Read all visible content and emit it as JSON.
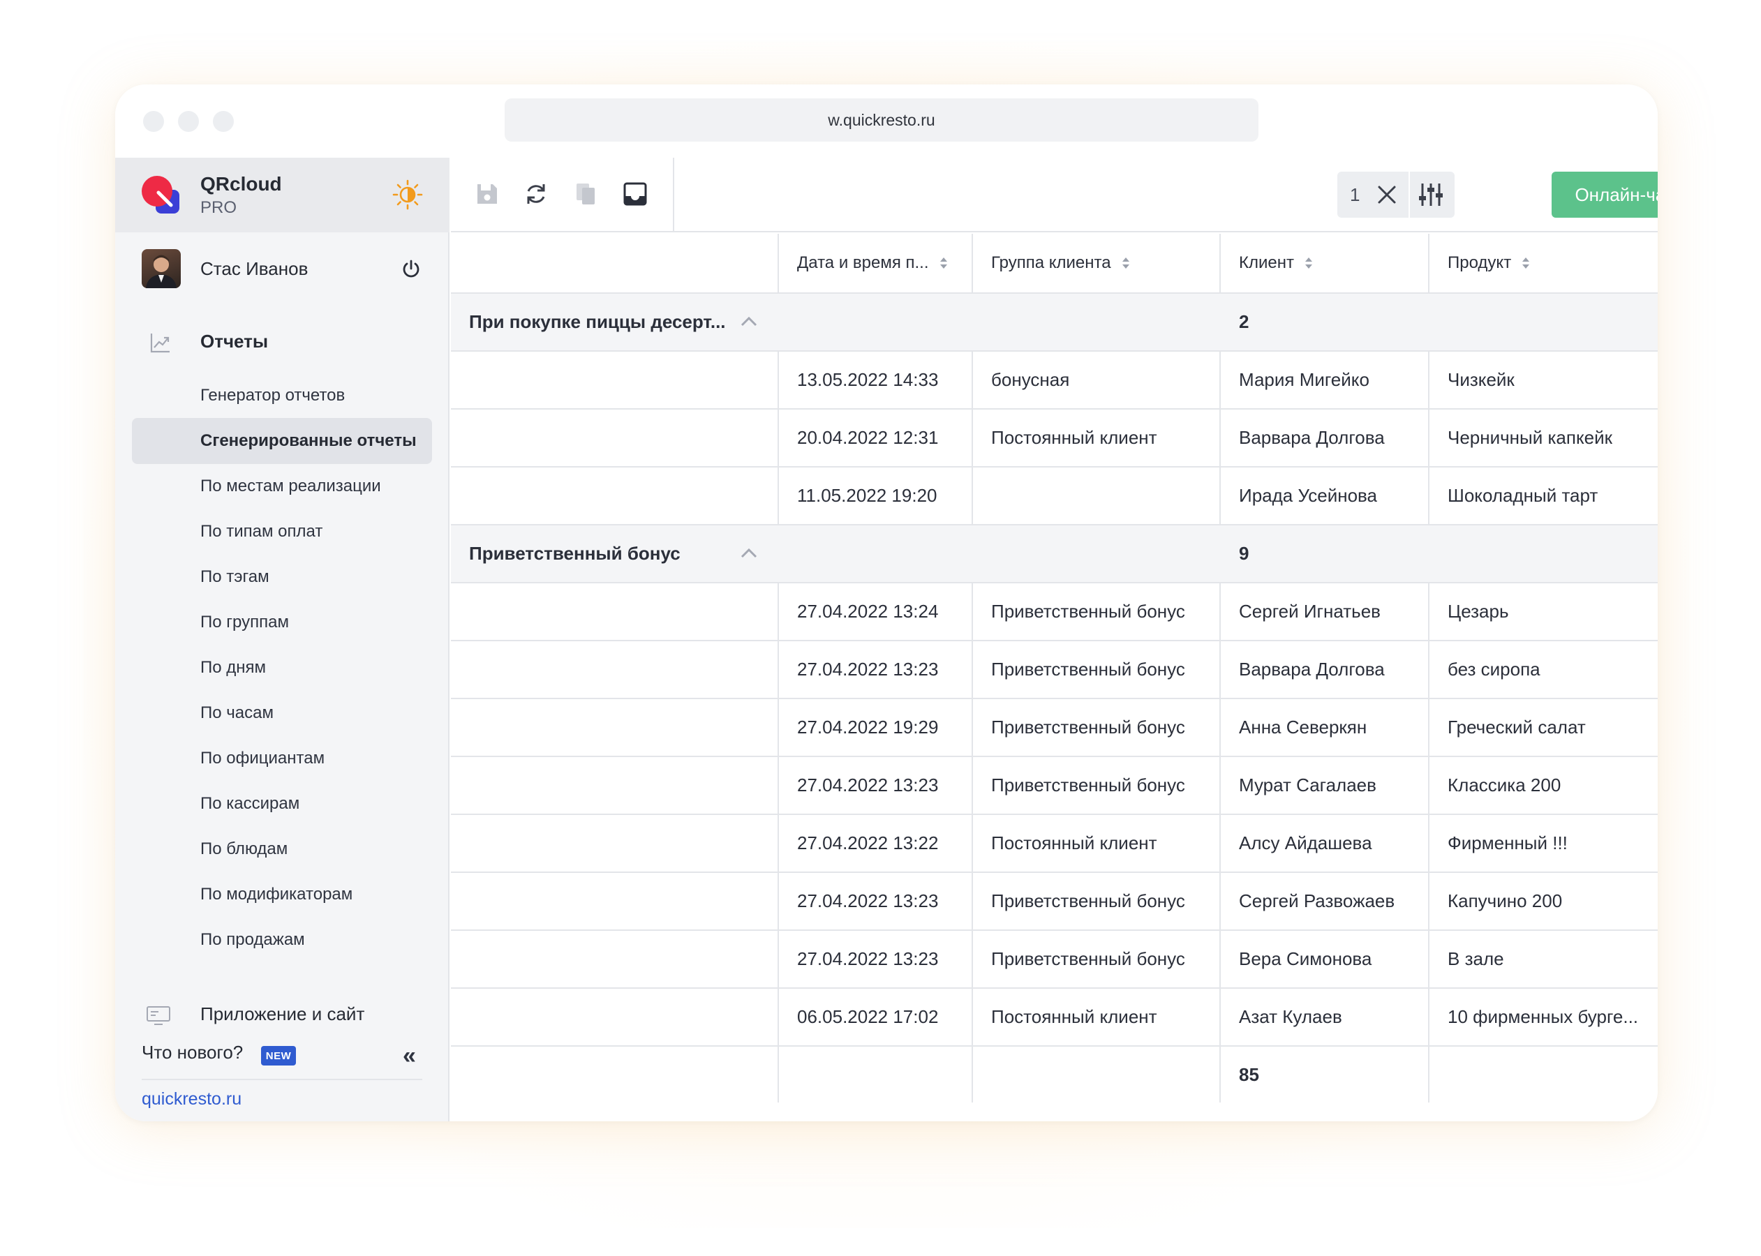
{
  "browser": {
    "url": "w.quickresto.ru"
  },
  "brand": {
    "name": "QRcloud",
    "tier": "PRO"
  },
  "user": {
    "name": "Стас Иванов"
  },
  "sidebar": {
    "section_title": "Отчеты",
    "items": [
      {
        "label": "Генератор отчетов"
      },
      {
        "label": "Сгенерированные отчеты",
        "active": true
      },
      {
        "label": "По местам реализации"
      },
      {
        "label": "По типам оплат"
      },
      {
        "label": "По тэгам"
      },
      {
        "label": "По группам"
      },
      {
        "label": "По дням"
      },
      {
        "label": "По часам"
      },
      {
        "label": "По официантам"
      },
      {
        "label": "По кассирам"
      },
      {
        "label": "По блюдам"
      },
      {
        "label": "По модификаторам"
      },
      {
        "label": "По продажам"
      }
    ],
    "apps_label": "Приложение и сайт",
    "news_label": "Что нового?",
    "new_badge": "NEW",
    "collapse_label": "«",
    "site_link": "quickresto.ru"
  },
  "toolbar": {
    "filter_count": "1",
    "chat_label": "Онлайн-чат"
  },
  "table": {
    "columns": [
      "Дата и время п...",
      "Группа клиента",
      "Клиент",
      "Продукт"
    ],
    "groups": [
      {
        "title": "При покупке пиццы десерт...",
        "count": "2",
        "rows": [
          [
            "13.05.2022 14:33",
            "бонусная",
            "Мария Мигейко",
            "Чизкейк"
          ],
          [
            "20.04.2022 12:31",
            "Постоянный клиент",
            "Варвара Долгова",
            "Черничный капкейк"
          ],
          [
            "11.05.2022 19:20",
            "",
            "Ирада Усейнова",
            "Шоколадный тарт"
          ]
        ]
      },
      {
        "title": "Приветственный бонус",
        "count": "9",
        "rows": [
          [
            "27.04.2022 13:24",
            "Приветственный бонус",
            "Сергей Игнатьев",
            "Цезарь"
          ],
          [
            "27.04.2022 13:23",
            "Приветственный бонус",
            "Варвара Долгова",
            "без сиропа"
          ],
          [
            "27.04.2022 19:29",
            "Приветственный бонус",
            "Анна Северкян",
            "Греческий салат"
          ],
          [
            "27.04.2022 13:23",
            "Приветственный бонус",
            "Мурат Сагалаев",
            "Классика 200"
          ],
          [
            "27.04.2022 13:22",
            "Постоянный клиент",
            "Алсу Айдашева",
            "Фирменный !!!"
          ],
          [
            "27.04.2022 13:23",
            "Приветственный бонус",
            "Сергей Развожаев",
            "Капучино 200"
          ],
          [
            "27.04.2022 13:23",
            "Приветственный бонус",
            "Вера Симонова",
            "В зале"
          ],
          [
            "06.05.2022 17:02",
            "Постоянный клиент",
            "Азат Кулаев",
            "10 фирменных бурге..."
          ]
        ]
      }
    ],
    "total": "85"
  },
  "colors": {
    "accent_green": "#5cc28b",
    "link_blue": "#2f5bd0",
    "logo_red": "#ee2a45",
    "logo_blue": "#3b3fd6",
    "sun_orange": "#f29b1d"
  },
  "icons": [
    "save-icon",
    "refresh-icon",
    "copy-icon",
    "inbox-icon",
    "close-icon",
    "sliders-icon",
    "sun-icon",
    "power-icon",
    "chart-icon",
    "monitor-icon",
    "chevron-up-icon"
  ]
}
